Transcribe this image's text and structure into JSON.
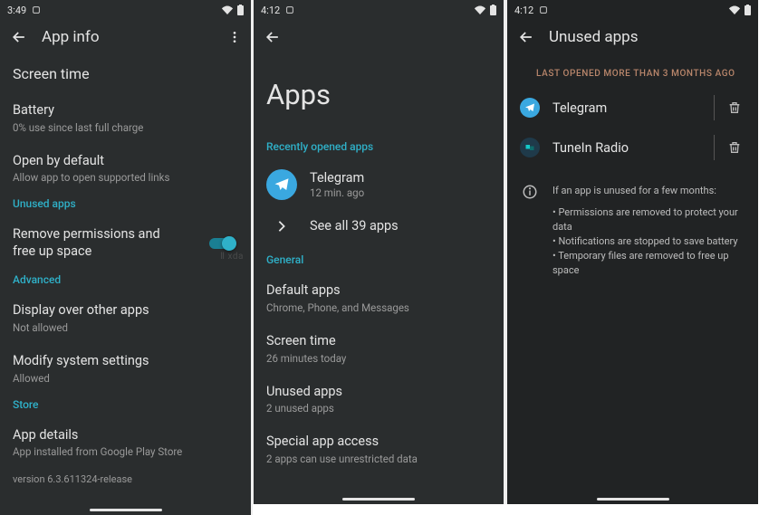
{
  "panel1": {
    "status": {
      "time": "3:49"
    },
    "header": {
      "title": "App info"
    },
    "screen_time": {
      "title": "Screen time"
    },
    "battery": {
      "title": "Battery",
      "sub": "0% use since last full charge"
    },
    "open_default": {
      "title": "Open by default",
      "sub": "Allow app to open supported links"
    },
    "unused_section": "Unused apps",
    "remove_perm": {
      "title": "Remove permissions and free up space"
    },
    "watermark": "Ⅱ xda",
    "advanced_section": "Advanced",
    "display_over": {
      "title": "Display over other apps",
      "sub": "Not allowed"
    },
    "modify_system": {
      "title": "Modify system settings",
      "sub": "Allowed"
    },
    "store_section": "Store",
    "app_details": {
      "title": "App details",
      "sub": "App installed from Google Play Store"
    },
    "version": "version 6.3.611324-release"
  },
  "panel2": {
    "status": {
      "time": "4:12"
    },
    "big_title": "Apps",
    "recent_section": "Recently opened apps",
    "telegram": {
      "name": "Telegram",
      "sub": "12 min. ago"
    },
    "see_all": "See all 39 apps",
    "general_section": "General",
    "default_apps": {
      "title": "Default apps",
      "sub": "Chrome, Phone, and Messages"
    },
    "screen_time": {
      "title": "Screen time",
      "sub": "26 minutes today"
    },
    "unused_apps": {
      "title": "Unused apps",
      "sub": "2 unused apps"
    },
    "special_access": {
      "title": "Special app access",
      "sub": "2 apps can use unrestricted data"
    }
  },
  "panel3": {
    "status": {
      "time": "4:12"
    },
    "header": {
      "title": "Unused apps"
    },
    "caption": "LAST OPENED MORE THAN 3 MONTHS AGO",
    "app1": {
      "name": "Telegram"
    },
    "app2": {
      "name": "TuneIn Radio"
    },
    "info": {
      "intro": "If an app is unused for a few months:",
      "b1": "• Permissions are removed to protect your data",
      "b2": "• Notifications are stopped to save battery",
      "b3": "• Temporary files are removed to free up space"
    }
  }
}
